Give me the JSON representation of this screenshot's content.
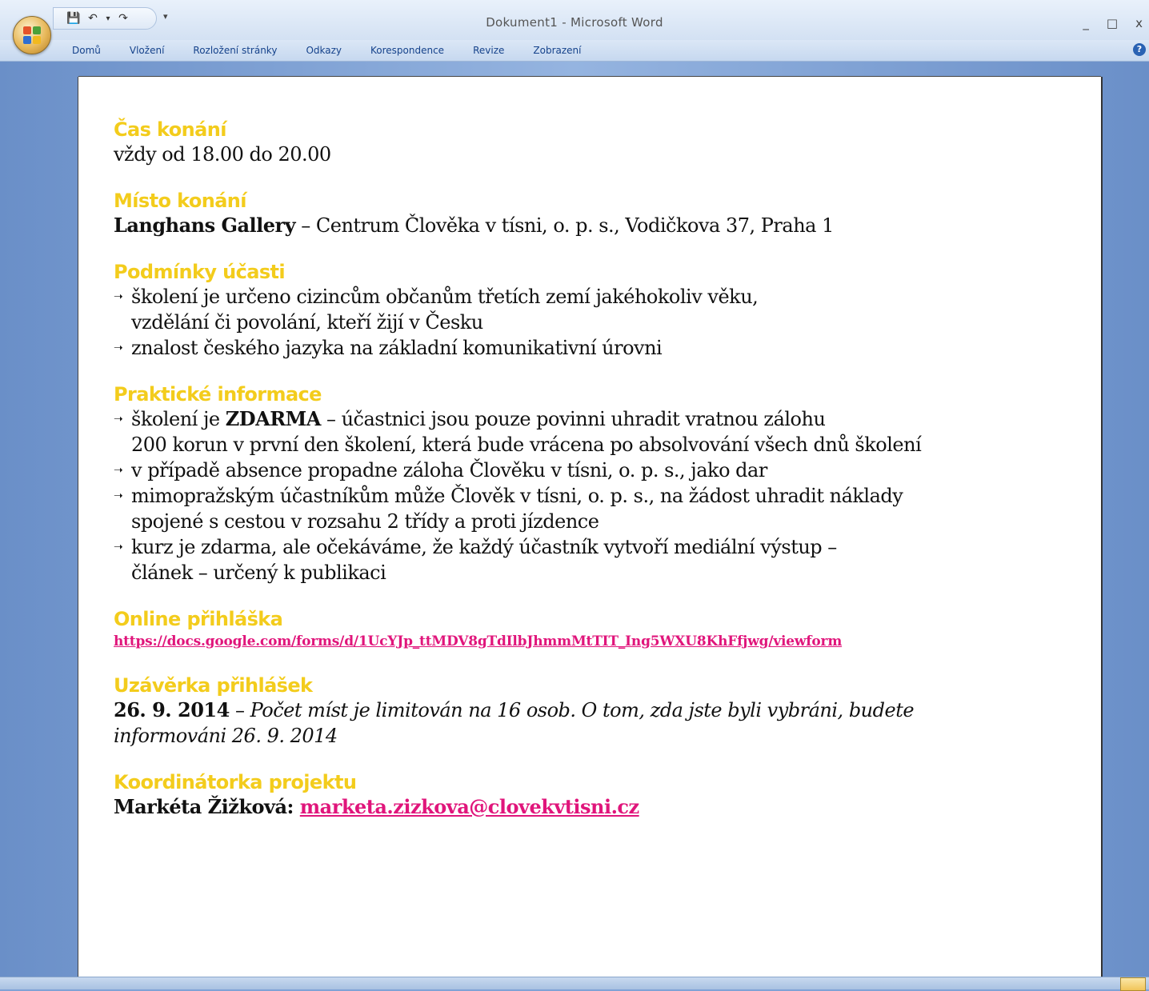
{
  "window": {
    "title": "Dokument1 - Microsoft Word",
    "controls": {
      "minimize": "_",
      "maximize": "□",
      "close": "x"
    }
  },
  "quick_access": {
    "save": "💾",
    "undo": "↶",
    "undo_more": "▾",
    "redo": "↷",
    "customize": "▾"
  },
  "ribbon": {
    "tabs": [
      "Domů",
      "Vložení",
      "Rozložení stránky",
      "Odkazy",
      "Korespondence",
      "Revize",
      "Zobrazení"
    ],
    "help": "?"
  },
  "document": {
    "sections": {
      "cas": {
        "heading": "Čas konání",
        "text": "vždy od 18.00 do 20.00"
      },
      "misto": {
        "heading": "Místo konání",
        "bold": "Langhans Gallery",
        "text": " – Centrum Člověka v tísni, o. p. s., Vodičkova 37, Praha 1"
      },
      "podminky": {
        "heading": "Podmínky účasti",
        "bullets": [
          "školení je určeno cizincům občanům třetích zemí jakéhokoliv věku,",
          "znalost českého jazyka na základní komunikativní úrovni"
        ],
        "bullet1_cont": "vzdělání či povolání, kteří žijí v Česku"
      },
      "prakticke": {
        "heading": "Praktické informace",
        "b1_pre": "školení je ",
        "b1_bold": "ZDARMA",
        "b1_post": " – účastnici jsou pouze povinni uhradit vratnou zálohu",
        "b1_cont": "200 korun v první den školení, která bude vrácena po absolvování všech dnů školení",
        "b2": "v případě absence propadne záloha Člověku v tísni, o. p. s., jako dar",
        "b3": "mimopražským účastníkům může Člověk v tísni, o. p. s., na žádost uhradit náklady",
        "b3_cont": "spojené s cestou v rozsahu 2 třídy a proti jízdence",
        "b4": "kurz je zdarma, ale očekáváme, že každý účastník vytvoří mediální výstup –",
        "b4_cont": "článek – určený k publikaci"
      },
      "online": {
        "heading": "Online přihláška",
        "link": "https://docs.google.com/forms/d/1UcYJp_ttMDV8gTdIlbJhmmMtTIT_Ing5WXU8KhFfjwg/viewform"
      },
      "uzaverka": {
        "heading": "Uzávěrka přihlášek",
        "bold": "26. 9. 2014",
        "dash": " – ",
        "italic": "Počet míst je limitován na 16 osob. O tom, zda jste byli vybráni, budete",
        "italic_cont": "informováni 26. 9. 2014"
      },
      "koordinatorka": {
        "heading": "Koordinátorka projektu",
        "name": "Markéta Žižková: ",
        "email": "marketa.zizkova@clovekvtisni.cz"
      }
    },
    "bullet_glyph": "➝"
  },
  "colors": {
    "heading": "#f3cc1c",
    "link": "#e0157b",
    "ribbon_text": "#15428b"
  }
}
